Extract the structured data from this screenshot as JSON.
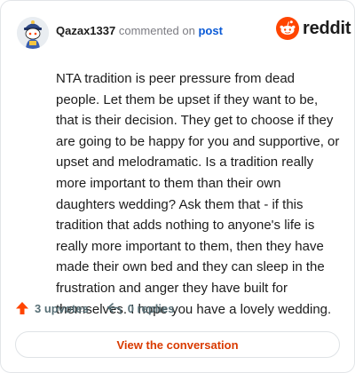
{
  "header": {
    "username": "Qazax1337",
    "commented_on": "commented on",
    "post_link": "post",
    "brand": "reddit"
  },
  "comment": {
    "text": "NTA tradition is peer pressure from dead people. Let them be upset if they want to be, that is their decision. They get to choose if they are going to be happy for you and supportive, or upset and melodramatic. Is a tradition really more important to them than their own daughters wedding? Ask them that - if this tradition that adds nothing to anyone's life is really more important to them, then they have made their own bed and they can sleep in the frustration and anger they have built for themselves. I hope you have a lovely wedding."
  },
  "actions": {
    "upvotes": "3 upvotes",
    "replies": "0 replies"
  },
  "cta": {
    "label": "View the conversation"
  },
  "icons": {
    "avatar": "snoo-avatar",
    "brand": "reddit-logo-icon",
    "upvote": "upvote-arrow-icon",
    "reply": "reply-arrow-icon"
  },
  "colors": {
    "brand_orange": "#ff4500",
    "link_blue": "#0a5ad6",
    "cta_text": "#d93a00",
    "muted": "#576f76"
  }
}
